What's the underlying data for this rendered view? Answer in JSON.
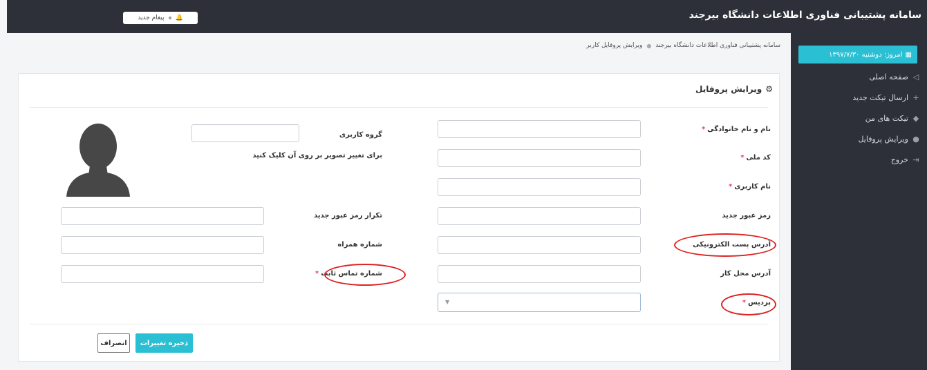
{
  "app": {
    "title": "سامانه پشتیبانی فناوری اطلاعات دانشگاه بیرجند"
  },
  "topbar": {
    "message_label": "پیغام جدید"
  },
  "sidebar": {
    "today": "امروز: دوشنبه ۱۳۹۷/۷/۳۰",
    "items": [
      {
        "label": "صفحه اصلی"
      },
      {
        "label": "ارسال تیکت جدید"
      },
      {
        "label": "تیکت های من"
      },
      {
        "label": "ویرایش پروفایل"
      },
      {
        "label": "خروج"
      }
    ]
  },
  "breadcrumb": {
    "home": "سامانه پشتیبانی فناوری اطلاعات دانشگاه بیرجند",
    "current": "ویرایش پروفایل کاربر"
  },
  "form": {
    "title": "ویرایش پروفایل",
    "required_mark": "*",
    "fields": {
      "full_name": "نام و نام خانوادگی",
      "national_code": "کد ملی",
      "username": "نام کاربری",
      "new_password": "رمز عبور جدید",
      "email": "آدرس پست الکترونیکی",
      "work_address": "آدرس محل کار",
      "campus": "پردیس",
      "user_group": "گروه کاربری",
      "change_photo_hint": "برای تغییر تصویر بر روی آن کلیک کنید",
      "confirm_password": "تکرار رمز عبور جدید",
      "mobile": "شماره همراه",
      "phone": "شماره تماس ثابت"
    },
    "buttons": {
      "save": "ذخیره تغییرات",
      "cancel": "انصراف"
    }
  }
}
